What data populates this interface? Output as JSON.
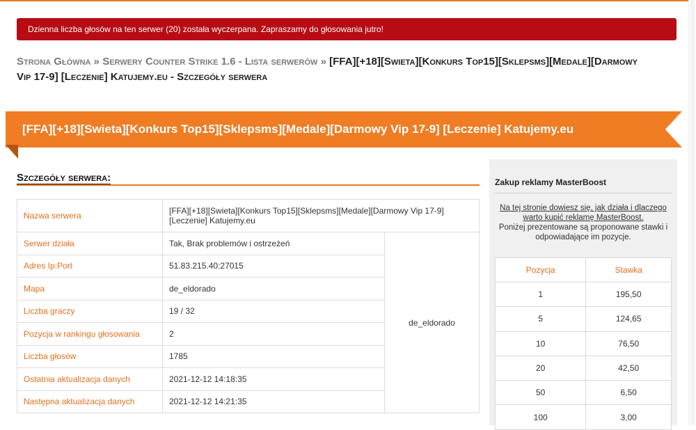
{
  "alert": {
    "text": "Dzienna liczba głosów na ten serwer (20) została wyczerpana. Zapraszamy do głosowania jutro!"
  },
  "breadcrumb": {
    "items": [
      "Strona Główna",
      "Serwery Counter Strike 1.6 - Lista serwerów"
    ],
    "separator": "»",
    "current": "[FFA][+18][Swieta][Konkurs Top15][Sklepsms][Medale][Darmowy Vip 17-9] [Leczenie] Katujemy.eu - Szczegóły serwera"
  },
  "server_title": "[FFA][+18][Swieta][Konkurs Top15][Sklepsms][Medale][Darmowy Vip 17-9] [Leczenie] Katujemy.eu",
  "details": {
    "heading": "Szczegóły serwera:",
    "map_preview_label": "de_eldorado",
    "rows": [
      {
        "label": "Nazwa serwera",
        "value": "[FFA][+18][Swieta][Konkurs Top15][Sklepsms][Medale][Darmowy Vip 17-9] [Leczenie] Katujemy.eu"
      },
      {
        "label": "Serwer działa",
        "value": "Tak, Brak problemów i ostrzeżeń"
      },
      {
        "label": "Adres Ip:Port",
        "value": "51.83.215.40:27015"
      },
      {
        "label": "Mapa",
        "value": "de_eldorado"
      },
      {
        "label": "Liczba graczy",
        "value": "19 / 32"
      },
      {
        "label": "Pozycja w rankingu głosowania",
        "value": "2"
      },
      {
        "label": "Liczba głosów",
        "value": "1785"
      },
      {
        "label": "Ostatnia aktualizacja danych",
        "value": "2021-12-12 14:18:35"
      },
      {
        "label": "Następna aktualizacja danych",
        "value": "2021-12-12 14:21:35"
      }
    ]
  },
  "sidebar": {
    "title": "Zakup reklamy MasterBoost",
    "link_text": "Na tej stronie dowiesz się, jak działa i dlaczego warto kupić reklamę MasterBoost.",
    "info_text": "Poniżej prezentowane są proponowane stawki i odpowiadające im pozycje.",
    "table": {
      "headers": [
        "Pozycja",
        "Stawka"
      ],
      "rows": [
        [
          "1",
          "195,50"
        ],
        [
          "5",
          "124,65"
        ],
        [
          "10",
          "76,50"
        ],
        [
          "20",
          "42,50"
        ],
        [
          "50",
          "6,50"
        ],
        [
          "100",
          "3,00"
        ]
      ]
    }
  },
  "colors": {
    "accent": "#f07c24",
    "alert_bg": "#b70c13",
    "label": "#e2701e"
  }
}
